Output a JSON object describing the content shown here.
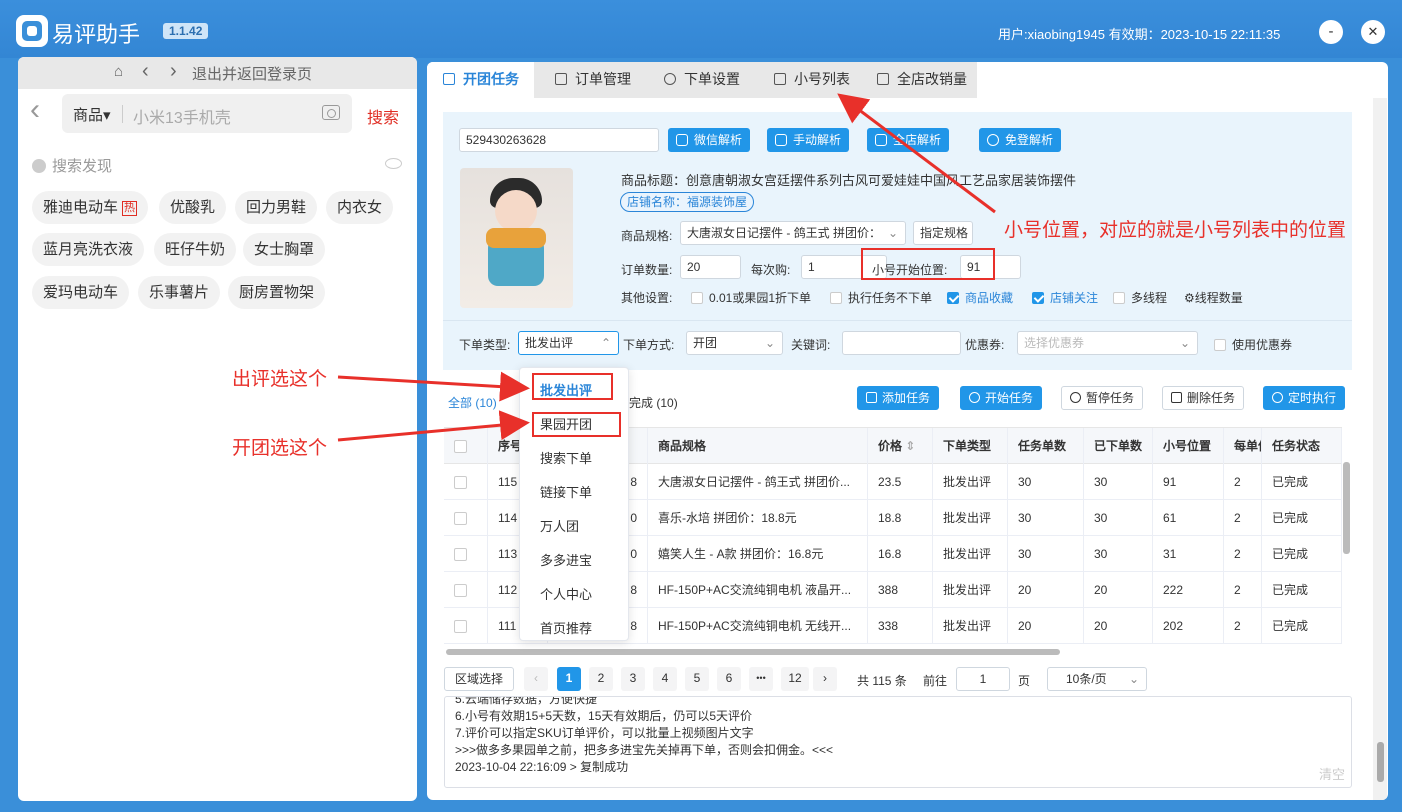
{
  "app": {
    "title": "易评助手",
    "version": "1.1.42",
    "user_info": "用户:xiaobing1945 有效期：2023-10-15 22:11:35",
    "minimize": "-",
    "close": "✕"
  },
  "left": {
    "nav_home": "⌂",
    "nav_back": "‹",
    "nav_forward": "›",
    "nav_exit": "退出并返回登录页",
    "back_arrow": "‹",
    "search_category": "商品▾",
    "search_text": "小米13手机壳",
    "search_button": "搜索",
    "discover_title": "搜索发现",
    "tags": [
      "雅迪电动车",
      "优酸乳",
      "回力男鞋",
      "内衣女",
      "蓝月亮洗衣液",
      "旺仔牛奶",
      "女士胸罩",
      "爱玛电动车",
      "乐事薯片",
      "厨房置物架"
    ],
    "hot_badge": "热"
  },
  "tabs": [
    "开团任务",
    "订单管理",
    "下单设置",
    "小号列表",
    "全店改销量"
  ],
  "form": {
    "goods_id": "529430263628",
    "buttons": [
      "微信解析",
      "手动解析",
      "全店解析",
      "免登解析"
    ],
    "title_label": "商品标题：",
    "title_value": "创意唐朝淑女宫廷摆件系列古风可爱娃娃中国风工艺品家居装饰摆件",
    "shop_name": "店铺名称：福源装饰屋",
    "spec_label": "商品规格:",
    "spec_value": "大唐淑女日记摆件 - 鸽王式 拼团价：",
    "spec_btn": "指定规格",
    "qty_label": "订单数量:",
    "qty_value": "20",
    "each_label": "每次购:",
    "each_value": "1",
    "start_label": "小号开始位置:",
    "start_value": "91",
    "other_label": "其他设置:",
    "options": [
      {
        "label": "0.01或果园1折下单",
        "checked": false
      },
      {
        "label": "执行任务不下单",
        "checked": false
      },
      {
        "label": "商品收藏",
        "checked": true
      },
      {
        "label": "店铺关注",
        "checked": true
      },
      {
        "label": "多线程",
        "checked": false
      }
    ],
    "thread_label": "⚙线程数量",
    "order_type_label": "下单类型:",
    "order_type_value": "批发出评",
    "order_method_label": "下单方式:",
    "order_method_value": "开团",
    "keyword_label": "关键词:",
    "coupon_label": "优惠券:",
    "coupon_placeholder": "选择优惠券",
    "use_coupon_label": "使用优惠券"
  },
  "annotations": {
    "position_note": "小号位置，对应的就是小号列表中的位置",
    "review_note": "出评选这个",
    "group_note": "开团选这个"
  },
  "dropdown": [
    "批发出评",
    "果园开团",
    "搜索下单",
    "链接下单",
    "万人团",
    "多多进宝",
    "个人中心",
    "首页推荐"
  ],
  "task_filters": {
    "all": "全部",
    "all_count": "(10)",
    "done": "完成",
    "done_count": "(10)"
  },
  "toolbar": [
    "添加任务",
    "开始任务",
    "暂停任务",
    "删除任务",
    "定时执行"
  ],
  "table": {
    "columns": [
      "序号",
      "商品规格",
      "价格",
      "下单类型",
      "任务单数",
      "已下单数",
      "小号位置",
      "每单件",
      "任务状态"
    ],
    "rows": [
      {
        "id": "115",
        "frag": "8",
        "spec": "大唐淑女日记摆件 - 鸽王式 拼团价...",
        "price": "23.5",
        "type": "批发出评",
        "tasks": "30",
        "done": "30",
        "pos": "91",
        "each": "2",
        "status": "已完成"
      },
      {
        "id": "114",
        "frag": "0",
        "spec": "喜乐-水培 拼团价：18.8元",
        "price": "18.8",
        "type": "批发出评",
        "tasks": "30",
        "done": "30",
        "pos": "61",
        "each": "2",
        "status": "已完成"
      },
      {
        "id": "113",
        "frag": "0",
        "spec": "嬉笑人生 - A款 拼团价：16.8元",
        "price": "16.8",
        "type": "批发出评",
        "tasks": "30",
        "done": "30",
        "pos": "31",
        "each": "2",
        "status": "已完成"
      },
      {
        "id": "112",
        "frag": "8",
        "spec": "HF-150P+AC交流纯铜电机 液晶开...",
        "price": "388",
        "type": "批发出评",
        "tasks": "20",
        "done": "20",
        "pos": "222",
        "each": "2",
        "status": "已完成"
      },
      {
        "id": "111",
        "frag": "8",
        "spec": "HF-150P+AC交流纯铜电机 无线开...",
        "price": "338",
        "type": "批发出评",
        "tasks": "20",
        "done": "20",
        "pos": "202",
        "each": "2",
        "status": "已完成"
      }
    ]
  },
  "pagination": {
    "region_btn": "区域选择",
    "prev": "‹",
    "pages": [
      "1",
      "2",
      "3",
      "4",
      "5",
      "6",
      "•••",
      "12"
    ],
    "next": "›",
    "total": "共 115 条",
    "goto_label": "前往",
    "goto_value": "1",
    "page_unit": "页",
    "page_size": "10条/页"
  },
  "log": {
    "lines": [
      "5.云端储存数据，方便快捷",
      "6.小号有效期15+5天数，15天有效期后，仍可以5天评价",
      "7.评价可以指定SKU订单评价，可以批量上视频图片文字",
      ">>>做多多果园单之前，把多多进宝先关掉再下单，否则会扣佣金。<<<",
      "2023-10-04 22:16:09 > 复制成功"
    ],
    "clear": "清空"
  }
}
